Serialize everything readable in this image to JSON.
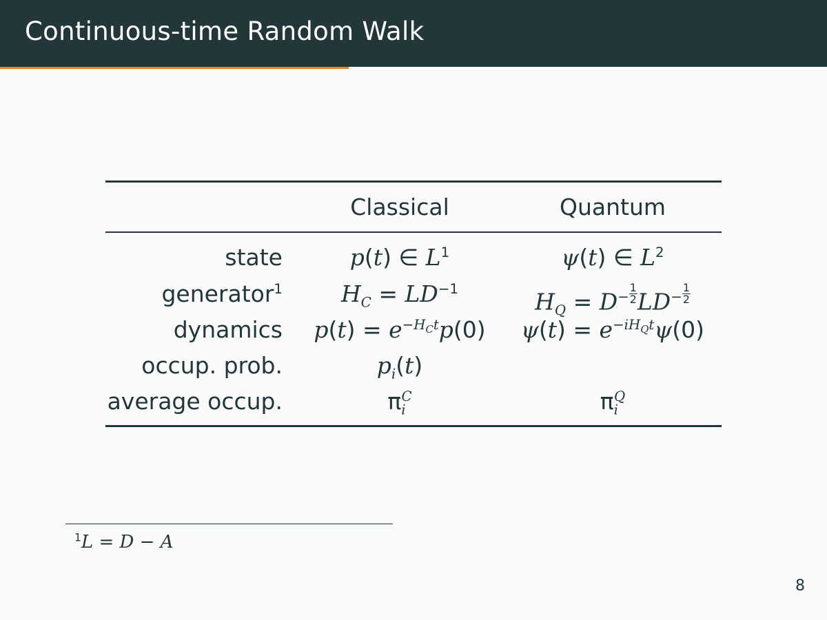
{
  "slide": {
    "title": "Continuous-time Random Walk",
    "page_number": "8"
  },
  "table": {
    "header": {
      "col1": "Classical",
      "col2": "Quantum"
    },
    "rows": [
      {
        "label": "state",
        "label_sup": "",
        "classical": "p(t) ∈ L¹",
        "quantum": "ψ(t) ∈ L²"
      },
      {
        "label": "generator",
        "label_sup": "1",
        "classical": "H_C = LD⁻¹",
        "quantum": "H_Q = D^{-1/2} L D^{-1/2}"
      },
      {
        "label": "dynamics",
        "label_sup": "",
        "classical": "p(t) = e^{-H_C t} p(0)",
        "quantum": "ψ(t) = e^{-iH_Q t} ψ(0)"
      },
      {
        "label": "occup. prob.",
        "label_sup": "",
        "classical": "p_i(t)",
        "quantum": ""
      },
      {
        "label": "average occup.",
        "label_sup": "",
        "classical": "π_i^C",
        "quantum": "π_i^Q"
      }
    ]
  },
  "footnote": {
    "mark": "1",
    "text": "L = D − A"
  }
}
